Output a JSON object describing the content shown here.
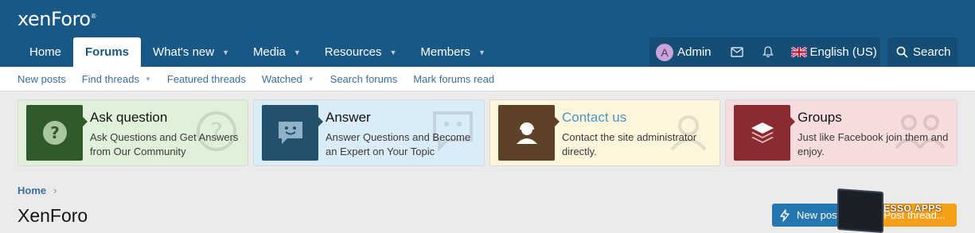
{
  "header": {
    "logo_text": "xenForo",
    "nav": [
      {
        "label": "Home",
        "has_menu": false,
        "active": false
      },
      {
        "label": "Forums",
        "has_menu": false,
        "active": true
      },
      {
        "label": "What's new",
        "has_menu": true,
        "active": false
      },
      {
        "label": "Media",
        "has_menu": true,
        "active": false
      },
      {
        "label": "Resources",
        "has_menu": true,
        "active": false
      },
      {
        "label": "Members",
        "has_menu": true,
        "active": false
      }
    ],
    "user": {
      "avatar_letter": "A",
      "name": "Admin"
    },
    "language": "English (US)",
    "search_label": "Search"
  },
  "subnav": [
    {
      "label": "New posts",
      "has_menu": false
    },
    {
      "label": "Find threads",
      "has_menu": true
    },
    {
      "label": "Featured threads",
      "has_menu": false
    },
    {
      "label": "Watched",
      "has_menu": true
    },
    {
      "label": "Search forums",
      "has_menu": false
    },
    {
      "label": "Mark forums read",
      "has_menu": false
    }
  ],
  "cards": [
    {
      "title": "Ask question",
      "description": "Ask Questions and Get Answers from Our Community",
      "icon": "question-icon",
      "bg": "#e1f1d9",
      "box": "#2e5a2c",
      "title_color": "#141414"
    },
    {
      "title": "Answer",
      "description": "Answer Questions and Become an Expert on Your Topic",
      "icon": "chat-smile-icon",
      "bg": "#d9ecf7",
      "box": "#23506d",
      "title_color": "#141414"
    },
    {
      "title": "Contact us",
      "description": "Contact the site administrator directly.",
      "icon": "support-agent-icon",
      "bg": "#fdf6dd",
      "box": "#5e4227",
      "title_color": "#4d95c4"
    },
    {
      "title": "Groups",
      "description": "Just like Facebook join them and enjoy.",
      "icon": "layers-icon",
      "bg": "#f6dcdc",
      "box": "#8a2b33",
      "title_color": "#141414"
    }
  ],
  "breadcrumb": {
    "home": "Home"
  },
  "page_title": "XenForo",
  "actions": {
    "new_posts": "New posts",
    "post_thread": "Post thread..."
  },
  "promo": {
    "brand": "ESSO APPS"
  }
}
